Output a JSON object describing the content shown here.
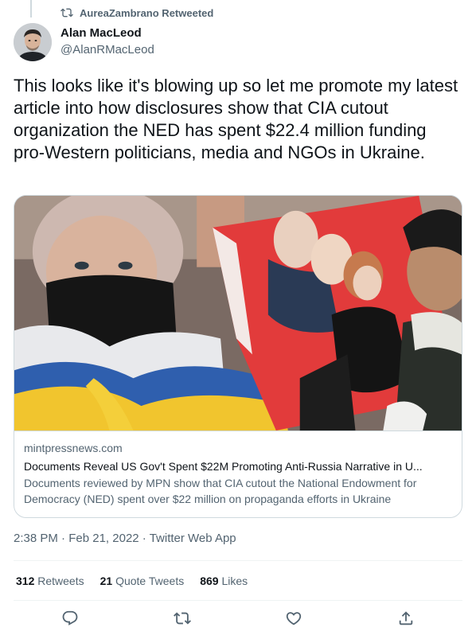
{
  "retweet": {
    "icon": "retweet-icon",
    "text": "AureaZambrano Retweeted"
  },
  "author": {
    "name": "Alan MacLeod",
    "handle": "@AlanRMacLeod"
  },
  "tweet": {
    "text": "This looks like it's blowing up so let me promote my latest article into how disclosures show that CIA cutout organization the NED has spent $22.4 million funding pro-Western politicians, media and NGOs in Ukraine."
  },
  "card": {
    "domain": "mintpressnews.com",
    "title": "Documents Reveal US Gov't Spent $22M Promoting Anti-Russia Narrative in U...",
    "description": "Documents reviewed by MPN show that CIA cutout the National Endowment for Democracy (NED) spent over $22 million on propaganda efforts in Ukraine"
  },
  "meta": {
    "time": "2:38 PM",
    "date": "Feb 21, 2022",
    "source": "Twitter Web App",
    "separator": " · "
  },
  "stats": {
    "retweets_count": "312",
    "retweets_label": "Retweets",
    "quotes_count": "21",
    "quotes_label": "Quote Tweets",
    "likes_count": "869",
    "likes_label": "Likes"
  },
  "actions": [
    {
      "icon": "reply-icon"
    },
    {
      "icon": "retweet-icon"
    },
    {
      "icon": "like-icon"
    },
    {
      "icon": "share-icon"
    }
  ],
  "colors": {
    "primary_text": "#0f1419",
    "secondary_text": "#536471",
    "border": "#cfd9de",
    "divider": "#eff3f4"
  }
}
